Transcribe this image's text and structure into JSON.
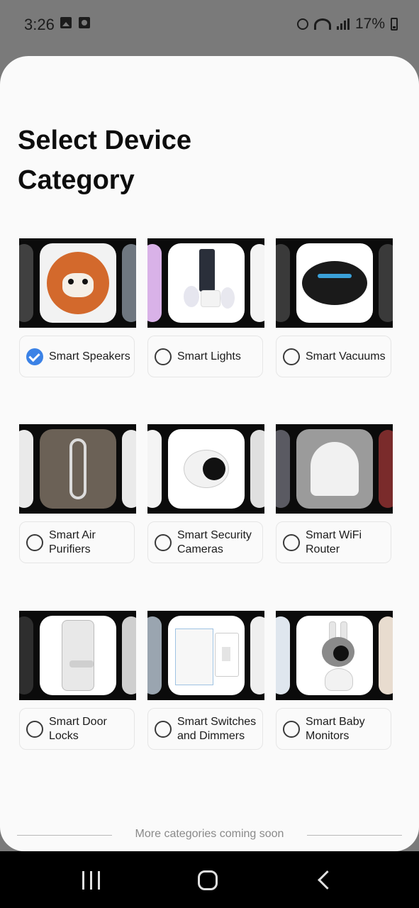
{
  "status_bar": {
    "time": "3:26",
    "battery": "17%",
    "icons": [
      "gallery-icon",
      "clock-icon",
      "alarm-icon",
      "wifi-icon",
      "signal-icon",
      "battery-icon"
    ]
  },
  "sheet": {
    "title": "Select Device Category",
    "categories": [
      {
        "label": "Smart Speakers",
        "selected": true,
        "image": "smart-speaker-image"
      },
      {
        "label": "Smart Lights",
        "selected": false,
        "image": "smart-lights-image"
      },
      {
        "label": "Smart Vacuums",
        "selected": false,
        "image": "robot-vacuum-image"
      },
      {
        "label": "Smart Air Purifiers",
        "selected": false,
        "image": "air-purifier-image"
      },
      {
        "label": "Smart Security Cameras",
        "selected": false,
        "image": "security-camera-image"
      },
      {
        "label": "Smart WiFi Router",
        "selected": false,
        "image": "wifi-router-image"
      },
      {
        "label": "Smart Door Locks",
        "selected": false,
        "image": "door-lock-image"
      },
      {
        "label": "Smart Switches and Dimmers",
        "selected": false,
        "image": "light-switch-image"
      },
      {
        "label": "Smart Baby Monitors",
        "selected": false,
        "image": "baby-monitor-image"
      }
    ],
    "footer_text": "More categories coming soon"
  },
  "colors": {
    "accent": "#3b82e6",
    "sheet_bg": "#fafafa",
    "scrim": "#7a7a7a"
  }
}
